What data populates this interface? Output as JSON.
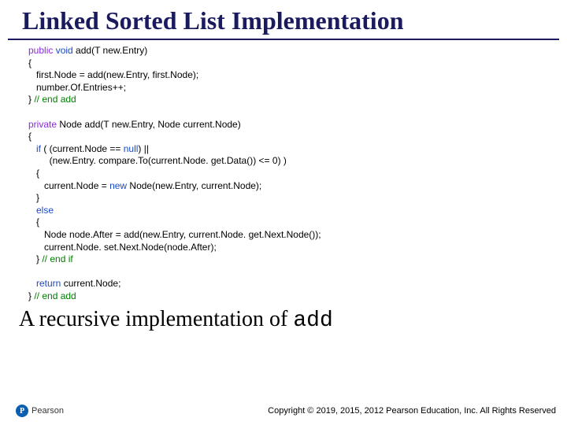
{
  "title": "Linked Sorted List Implementation",
  "code": {
    "l1a": "public",
    "l1b": " void",
    "l1c": " add(T new.Entry)",
    "l2": "{",
    "l3": "   first.Node = add(new.Entry, first.Node);",
    "l4": "   number.Of.Entries++;",
    "l5a": "} ",
    "l5b": "// end add",
    "l6": "",
    "l7a": "private",
    "l7b": " Node add(T new.Entry, Node current.Node)",
    "l8": "{",
    "l9a": "   if",
    "l9b": " ( (current.Node == ",
    "l9c": "null",
    "l9d": ") ||",
    "l10": "        (new.Entry. compare.To(current.Node. get.Data()) <= 0) )",
    "l11": "   {",
    "l12a": "      current.Node = ",
    "l12b": "new",
    "l12c": " Node(new.Entry, current.Node);",
    "l13": "   }",
    "l14a": "   else",
    "l15": "   {",
    "l16": "      Node node.After = add(new.Entry, current.Node. get.Next.Node());",
    "l17": "      current.Node. set.Next.Node(node.After);",
    "l18a": "   } ",
    "l18b": "// end if",
    "l19": "",
    "l20a": "   return",
    "l20b": " current.Node;",
    "l21a": "} ",
    "l21b": "// end add"
  },
  "subtitle_plain": "A recursive implementation of ",
  "subtitle_mono": "add",
  "logo_letter": "P",
  "logo_text": "Pearson",
  "copyright": "Copyright © 2019, 2015, 2012 Pearson Education, Inc. All Rights Reserved"
}
